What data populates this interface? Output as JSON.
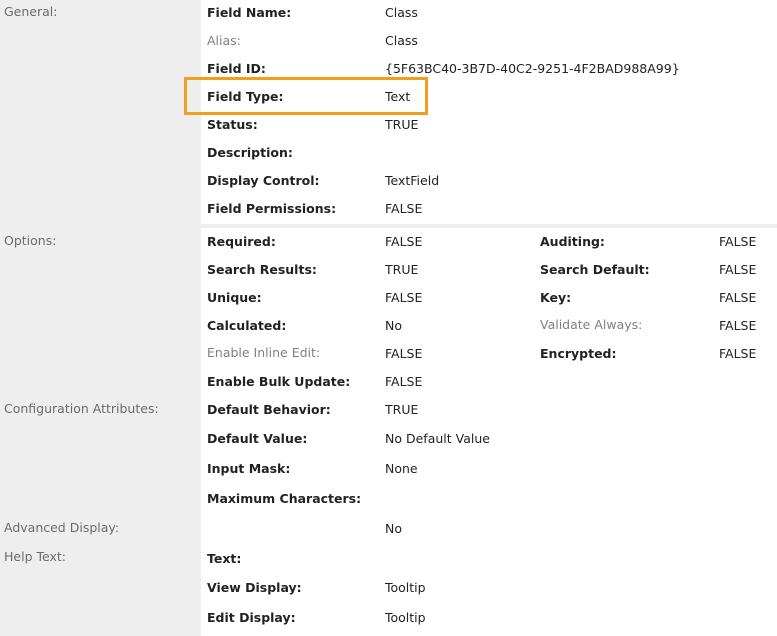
{
  "sections": {
    "general": "General:",
    "options": "Options:",
    "configuration": "Configuration Attributes:",
    "advanced_display": "Advanced Display:",
    "help_text": "Help Text:"
  },
  "general": {
    "field_name": {
      "label": "Field Name:",
      "value": "Class"
    },
    "alias": {
      "label": "Alias:",
      "value": "Class"
    },
    "field_id": {
      "label": "Field ID:",
      "value": "{5F63BC40-3B7D-40C2-9251-4F2BAD988A99}"
    },
    "field_type": {
      "label": "Field Type:",
      "value": "Text"
    },
    "status": {
      "label": "Status:",
      "value": "TRUE"
    },
    "description": {
      "label": "Description:",
      "value": ""
    },
    "display_control": {
      "label": "Display Control:",
      "value": "TextField"
    },
    "field_permissions": {
      "label": "Field Permissions:",
      "value": "FALSE"
    }
  },
  "options": {
    "required": {
      "label": "Required:",
      "value": "FALSE"
    },
    "auditing": {
      "label": "Auditing:",
      "value": "FALSE"
    },
    "search_results": {
      "label": "Search Results:",
      "value": "TRUE"
    },
    "search_default": {
      "label": "Search Default:",
      "value": "FALSE"
    },
    "unique": {
      "label": "Unique:",
      "value": "FALSE"
    },
    "key": {
      "label": "Key:",
      "value": "FALSE"
    },
    "calculated": {
      "label": "Calculated:",
      "value": "No"
    },
    "validate_always": {
      "label": "Validate Always:",
      "value": "FALSE"
    },
    "enable_inline_edit": {
      "label": "Enable Inline Edit:",
      "value": "FALSE"
    },
    "encrypted": {
      "label": "Encrypted:",
      "value": "FALSE"
    },
    "enable_bulk_update": {
      "label": "Enable Bulk Update:",
      "value": "FALSE"
    }
  },
  "configuration": {
    "default_behavior": {
      "label": "Default Behavior:",
      "value": "TRUE"
    },
    "default_value": {
      "label": "Default Value:",
      "value": "No Default Value"
    },
    "input_mask": {
      "label": "Input Mask:",
      "value": "None"
    },
    "maximum_characters": {
      "label": "Maximum Characters:",
      "value": ""
    }
  },
  "advanced_display": {
    "value": "No"
  },
  "help_text": {
    "text": {
      "label": "Text:",
      "value": ""
    },
    "view_display": {
      "label": "View Display:",
      "value": "Tooltip"
    },
    "edit_display": {
      "label": "Edit Display:",
      "value": "Tooltip"
    }
  },
  "colors": {
    "highlight": "#f39c1f",
    "left_panel": "#eeeeee"
  }
}
